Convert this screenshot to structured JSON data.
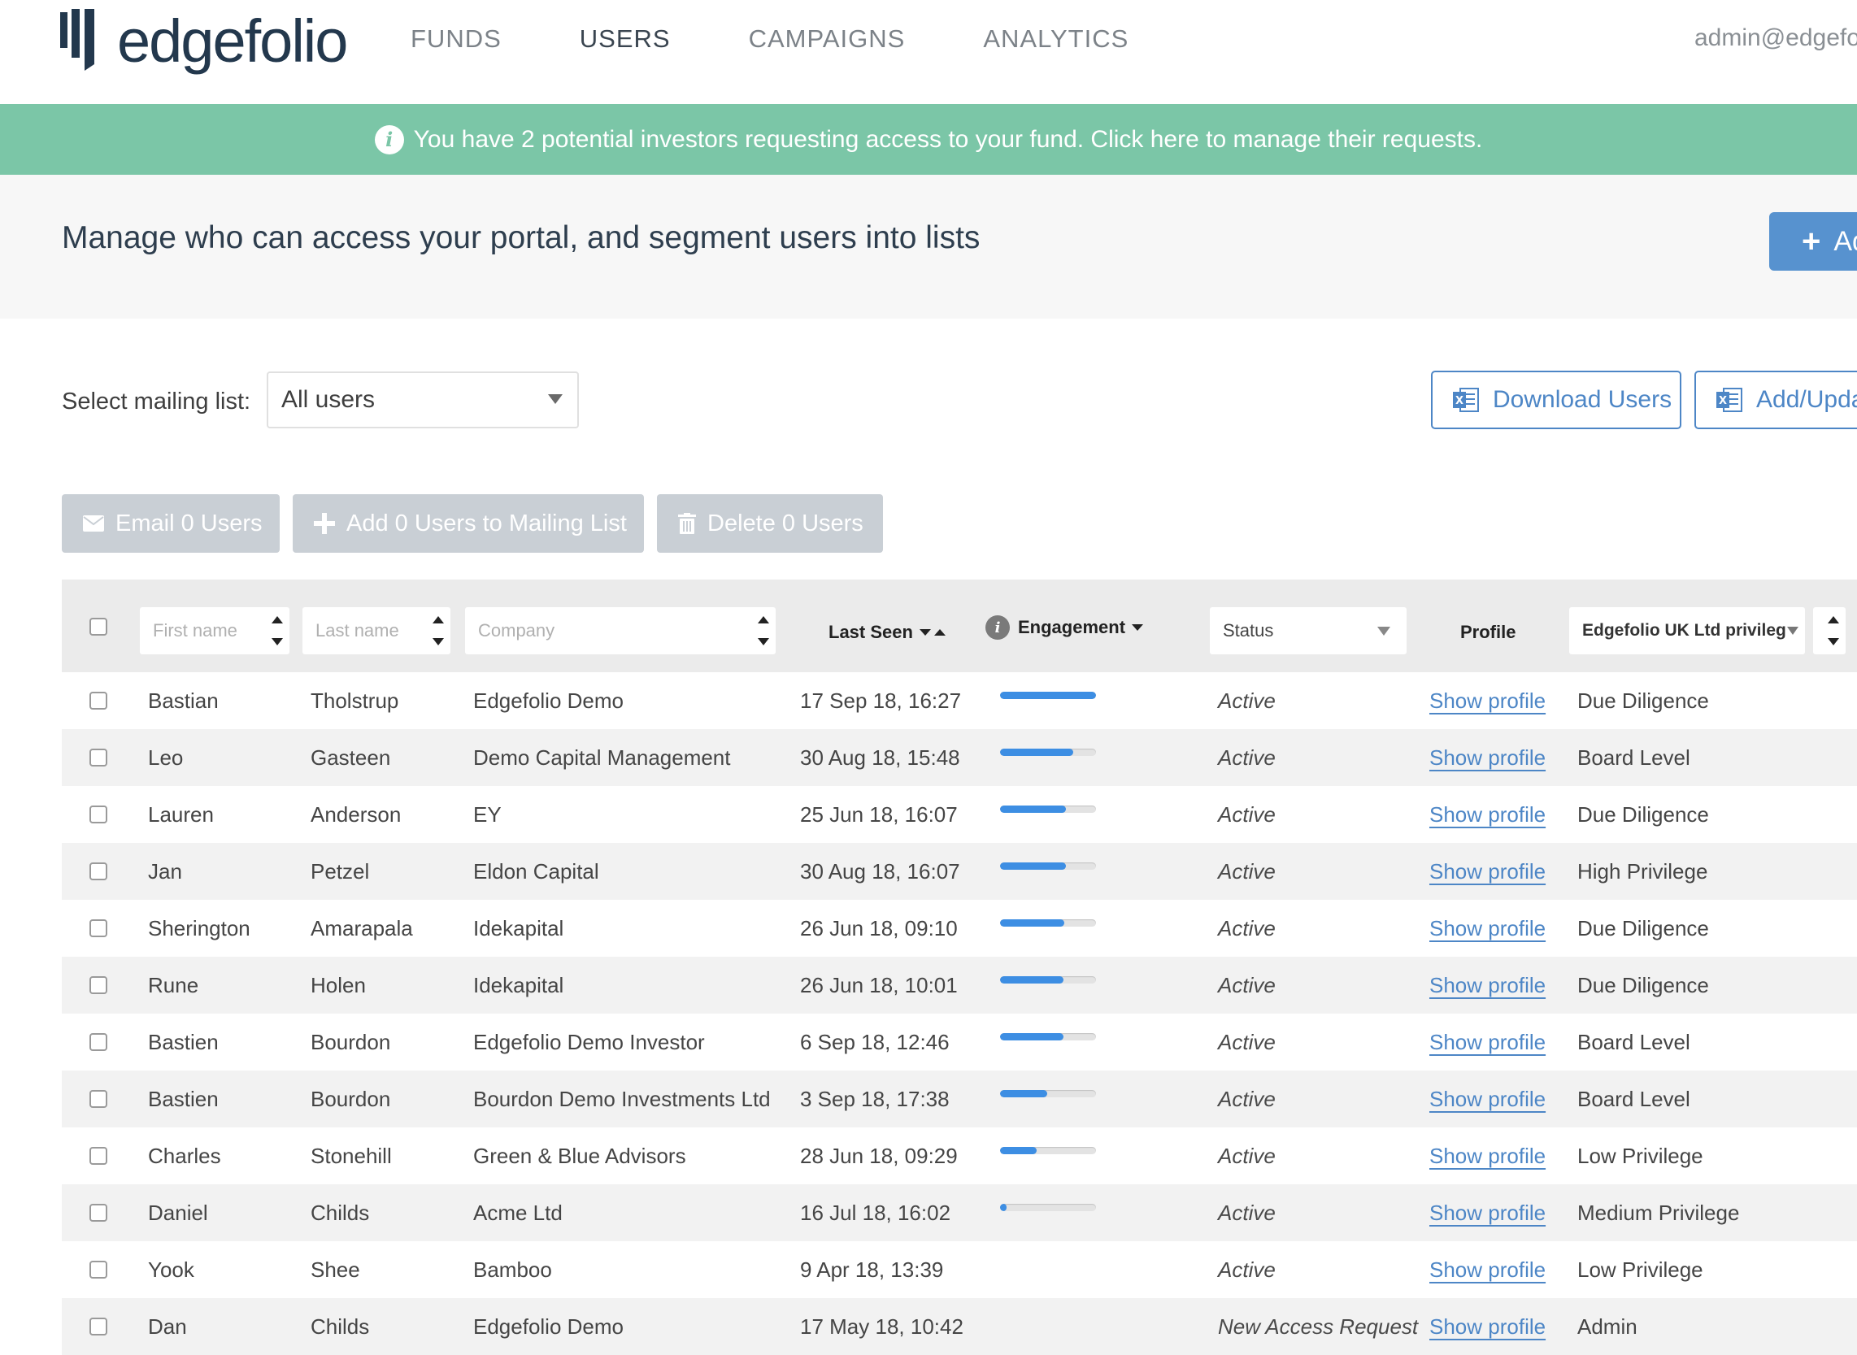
{
  "brand": {
    "name": "edgefolio"
  },
  "nav": {
    "items": [
      {
        "label": "FUNDS",
        "active": false
      },
      {
        "label": "USERS",
        "active": true
      },
      {
        "label": "CAMPAIGNS",
        "active": false
      },
      {
        "label": "ANALYTICS",
        "active": false
      }
    ],
    "account": "admin@edgefol"
  },
  "banner": {
    "text": "You have 2 potential investors requesting access to your fund. Click here to manage their requests."
  },
  "header": {
    "title": "Manage who can access your portal, and segment users into lists",
    "add_button": "Ad"
  },
  "mailing": {
    "label": "Select mailing list:",
    "selected": "All users"
  },
  "export": {
    "download_label": "Download Users",
    "add_update_label": "Add/Upda"
  },
  "actions": {
    "email": "Email 0 Users",
    "add_to_list": "Add 0 Users to Mailing List",
    "delete": "Delete 0 Users"
  },
  "table": {
    "filters": {
      "first_name": "First name",
      "last_name": "Last name",
      "company": "Company",
      "status": "Status",
      "privilege": "Edgefolio UK Ltd privileg"
    },
    "headers": {
      "last_seen": "Last Seen",
      "engagement": "Engagement",
      "profile": "Profile"
    },
    "rows": [
      {
        "first": "Bastian",
        "last": "Tholstrup",
        "company": "Edgefolio Demo",
        "seen": "17 Sep 18, 16:27",
        "engagement": 1.0,
        "status": "Active",
        "profile": "Show profile",
        "privilege": "Due Diligence"
      },
      {
        "first": "Leo",
        "last": "Gasteen",
        "company": "Demo Capital Management",
        "seen": "30 Aug 18, 15:48",
        "engagement": 0.76,
        "status": "Active",
        "profile": "Show profile",
        "privilege": "Board Level"
      },
      {
        "first": "Lauren",
        "last": "Anderson",
        "company": "EY",
        "seen": "25 Jun 18, 16:07",
        "engagement": 0.69,
        "status": "Active",
        "profile": "Show profile",
        "privilege": "Due Diligence"
      },
      {
        "first": "Jan",
        "last": "Petzel",
        "company": "Eldon Capital",
        "seen": "30 Aug 18, 16:07",
        "engagement": 0.69,
        "status": "Active",
        "profile": "Show profile",
        "privilege": "High Privilege"
      },
      {
        "first": "Sherington",
        "last": "Amarapala",
        "company": "Idekapital",
        "seen": "26 Jun 18, 09:10",
        "engagement": 0.67,
        "status": "Active",
        "profile": "Show profile",
        "privilege": "Due Diligence"
      },
      {
        "first": "Rune",
        "last": "Holen",
        "company": "Idekapital",
        "seen": "26 Jun 18, 10:01",
        "engagement": 0.66,
        "status": "Active",
        "profile": "Show profile",
        "privilege": "Due Diligence"
      },
      {
        "first": "Bastien",
        "last": "Bourdon",
        "company": "Edgefolio Demo Investor",
        "seen": "6 Sep 18, 12:46",
        "engagement": 0.66,
        "status": "Active",
        "profile": "Show profile",
        "privilege": "Board Level"
      },
      {
        "first": "Bastien",
        "last": "Bourdon",
        "company": "Bourdon Demo Investments Ltd",
        "seen": "3 Sep 18, 17:38",
        "engagement": 0.49,
        "status": "Active",
        "profile": "Show profile",
        "privilege": "Board Level"
      },
      {
        "first": "Charles",
        "last": "Stonehill",
        "company": "Green & Blue Advisors",
        "seen": "28 Jun 18, 09:29",
        "engagement": 0.38,
        "status": "Active",
        "profile": "Show profile",
        "privilege": "Low Privilege"
      },
      {
        "first": "Daniel",
        "last": "Childs",
        "company": "Acme Ltd",
        "seen": "16 Jul 18, 16:02",
        "engagement": 0.07,
        "status": "Active",
        "profile": "Show profile",
        "privilege": "Medium Privilege"
      },
      {
        "first": "Yook",
        "last": "Shee",
        "company": "Bamboo",
        "seen": "9 Apr 18, 13:39",
        "engagement": null,
        "status": "Active",
        "profile": "Show profile",
        "privilege": "Low Privilege"
      },
      {
        "first": "Dan",
        "last": "Childs",
        "company": "Edgefolio Demo",
        "seen": "17 May 18, 10:42",
        "engagement": null,
        "status": "New Access Request",
        "profile": "Show profile",
        "privilege": "Admin"
      }
    ]
  }
}
